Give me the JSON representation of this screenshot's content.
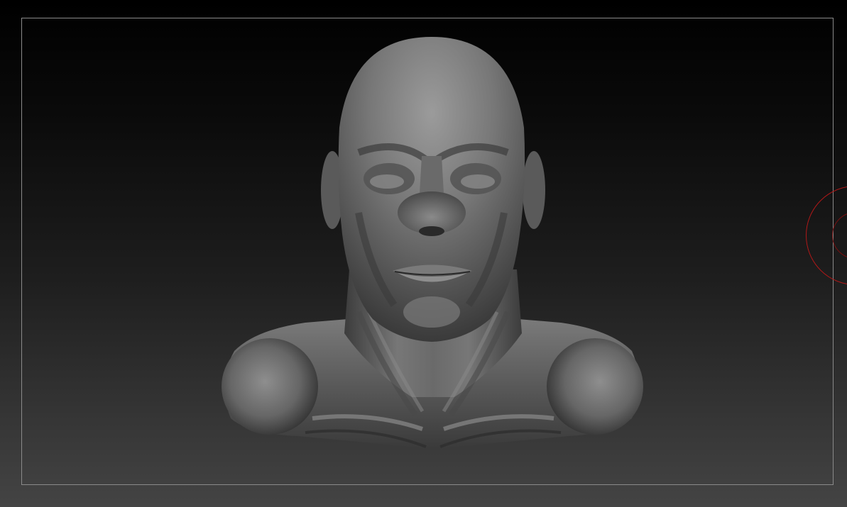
{
  "viewport": {
    "background_top": "#000000",
    "background_bottom": "#444444",
    "frame_color": "#8a8a8a"
  },
  "model": {
    "icon": "sculpted-bust-icon",
    "base_color": "#6e6e6e",
    "highlight_color": "#9a9a9a",
    "shadow_color": "#2a2a2a"
  },
  "brush": {
    "icon": "brush-cursor-icon",
    "color": "#b01818"
  }
}
